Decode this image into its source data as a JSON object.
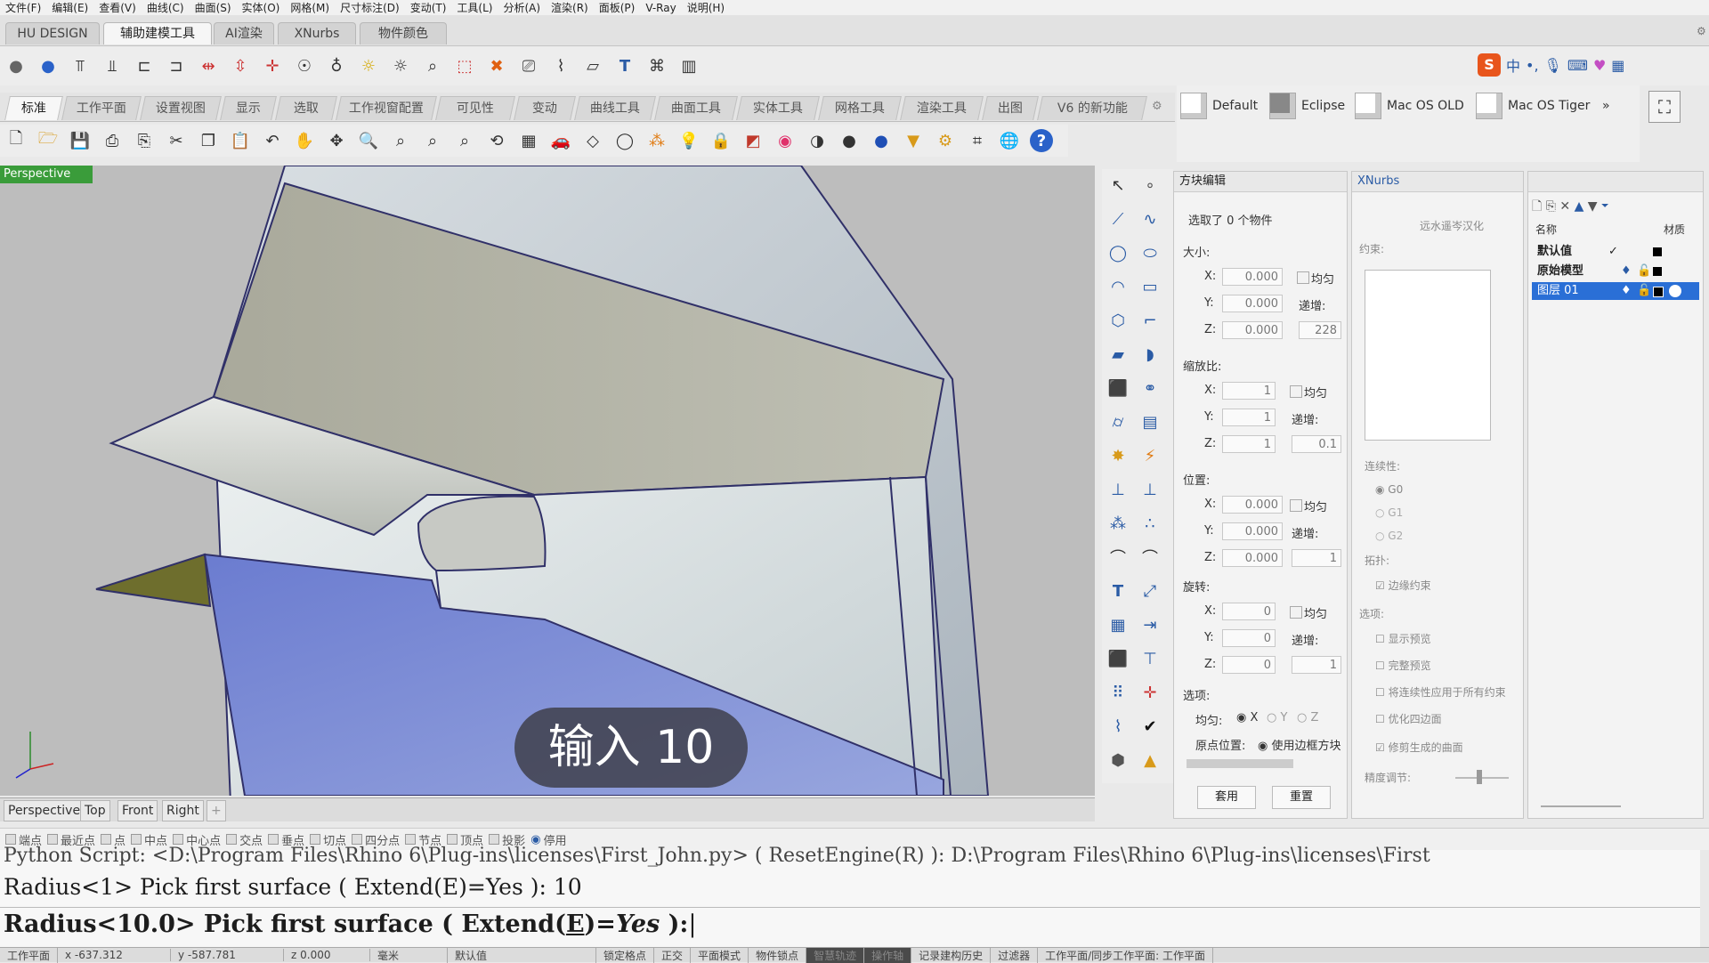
{
  "menu": [
    "文件(F)",
    "编辑(E)",
    "查看(V)",
    "曲线(C)",
    "曲面(S)",
    "实体(O)",
    "网格(M)",
    "尺寸标注(D)",
    "变动(T)",
    "工具(L)",
    "分析(A)",
    "渲染(R)",
    "面板(P)",
    "V-Ray",
    "说明(H)"
  ],
  "top_tabs": [
    "HU DESIGN",
    "辅助建模工具",
    "AI渲染",
    "XNurbs",
    "物件颜色"
  ],
  "ribbon_tabs": [
    "标准",
    "工作平面",
    "设置视图",
    "显示",
    "选取",
    "工作视窗配置",
    "可见性",
    "变动",
    "曲线工具",
    "曲面工具",
    "实体工具",
    "网格工具",
    "渲染工具",
    "出图",
    "V6 的新功能"
  ],
  "themes": [
    "Default",
    "Eclipse",
    "Mac OS OLD",
    "Mac OS Tiger"
  ],
  "theme_more": "»",
  "viewport": {
    "name": "Perspective",
    "subtitle": "输入 10"
  },
  "view_tabs": [
    "Perspective",
    "Top",
    "Front",
    "Right",
    "+"
  ],
  "snaps": [
    "端点",
    "最近点",
    "点",
    "中点",
    "中心点",
    "交点",
    "垂点",
    "切点",
    "四分点",
    "节点",
    "顶点",
    "投影",
    "停用"
  ],
  "command": {
    "line1": "Python Script: <D:\\Program Files\\Rhino 6\\Plug-ins\\licenses\\First_John.py> ( ResetEngine(R) ): D:\\Program Files\\Rhino 6\\Plug-ins\\licenses\\First",
    "line2": "Radius<1> Pick first surface ( Extend(E)=Yes ): 10",
    "line3_prefix": "Radius<10.0> Pick first surface ( Extend(",
    "line3_key": "E",
    "line3_mid": ")=",
    "line3_val": "Yes",
    "line3_suffix": " ):"
  },
  "status": [
    "工作平面",
    "x -637.312",
    "y -587.781",
    "z 0.000",
    "毫米",
    "默认值",
    "锁定格点",
    "正交",
    "平面模式",
    "物件锁点",
    "智慧轨迹",
    "操作轴",
    "记录建构历史",
    "过滤器",
    "工作平面/同步工作平面: 工作平面"
  ],
  "block_panel": {
    "title": "方块编辑",
    "selected": "选取了 0 个物件",
    "size_label": "大小:",
    "scale_label": "缩放比:",
    "pos_label": "位置:",
    "rot_label": "旋转:",
    "opt_label": "选项:",
    "uniform": "均匀",
    "increment": "递增:",
    "size": {
      "x": "0.000",
      "y": "0.000",
      "z": "0.000",
      "inc": "228"
    },
    "scale": {
      "x": "1",
      "y": "1",
      "z": "1",
      "inc": "0.1"
    },
    "pos": {
      "x": "0.000",
      "y": "0.000",
      "z": "0.000",
      "inc": "1"
    },
    "rot": {
      "x": "0",
      "y": "0",
      "z": "0",
      "inc": "1"
    },
    "uniform_opt": "均匀:",
    "axes": [
      "X",
      "Y",
      "Z"
    ],
    "origin": "原点位置:",
    "origin_val": "使用边框方块",
    "apply": "套用",
    "reset": "重置"
  },
  "xnurbs_panel": {
    "title": "XNurbs",
    "credit": "远水遥岑汉化",
    "constraint": "约束:",
    "continuity": "连续性:",
    "g": [
      "G0",
      "G1",
      "G2"
    ],
    "topology": "拓扑:",
    "edge_constraint": "边缘约束",
    "options": "选项:",
    "opts": [
      "显示预览",
      "完整预览",
      "将连续性应用于所有约束",
      "优化四边面",
      "修剪生成的曲面"
    ],
    "precision": "精度调节:"
  },
  "layers_panel": {
    "col_name": "名称",
    "col_material": "材质",
    "rows": [
      "默认值",
      "原始模型",
      "图层 01"
    ]
  }
}
